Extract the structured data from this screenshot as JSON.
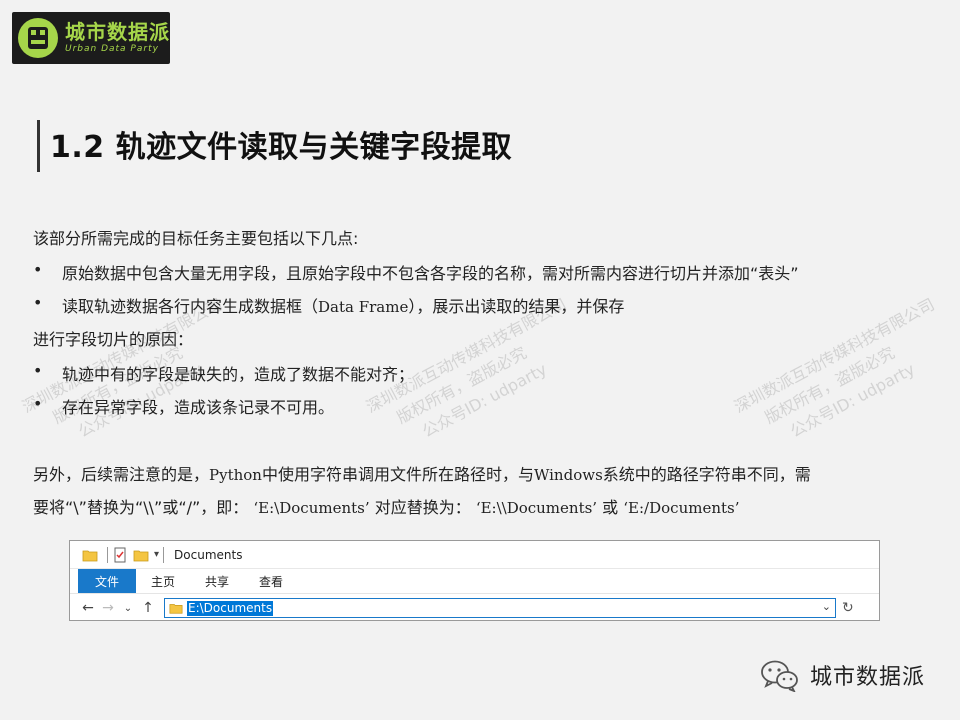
{
  "logo": {
    "name_cn": "城市数据派",
    "name_en": "Urban Data Party"
  },
  "title": "1.2 轨迹文件读取与关键字段提取",
  "intro": "该部分所需完成的目标任务主要包括以下几点:",
  "tasks": [
    "原始数据中包含大量无用字段，且原始字段中不包含各字段的名称，需对所需内容进行切片并添加“表头”",
    {
      "a": "读取轨迹数据各行内容生成数据框（",
      "b": "Data Frame",
      "c": "），展示出读取的结果，并保存"
    }
  ],
  "reason_heading": "进行字段切片的原因：",
  "reasons": [
    "轨迹中有的字段是缺失的，造成了数据不能对齐；",
    "存在异常字段，造成该条记录不可用。"
  ],
  "note": {
    "l1a": "另外，后续需注意的是，",
    "l1b": "Python",
    "l1c": "中使用字符串调用文件所在路径时，与",
    "l1d": "Windows",
    "l1e": "系统中的路径字符串不同，需",
    "l2a": "要将“\\”替换为“\\\\”或“/”，即：",
    "l2b": "‘E:\\Documents’",
    "l2c": "对应替换为：",
    "l2d": "‘E:\\\\Documents’",
    "l2e": "或",
    "l2f": "‘E:/Documents’"
  },
  "watermark": {
    "line1": "深圳数派互动传媒科技有限公司",
    "line2": "版权所有，盗版必究",
    "line3": "公众号ID: udparty"
  },
  "explorer": {
    "window_title": "Documents",
    "ribbon_tabs": [
      "文件",
      "主页",
      "共享",
      "查看"
    ],
    "address": "E:\\Documents",
    "accent": "#1979ca"
  },
  "footer": {
    "account": "城市数据派"
  }
}
